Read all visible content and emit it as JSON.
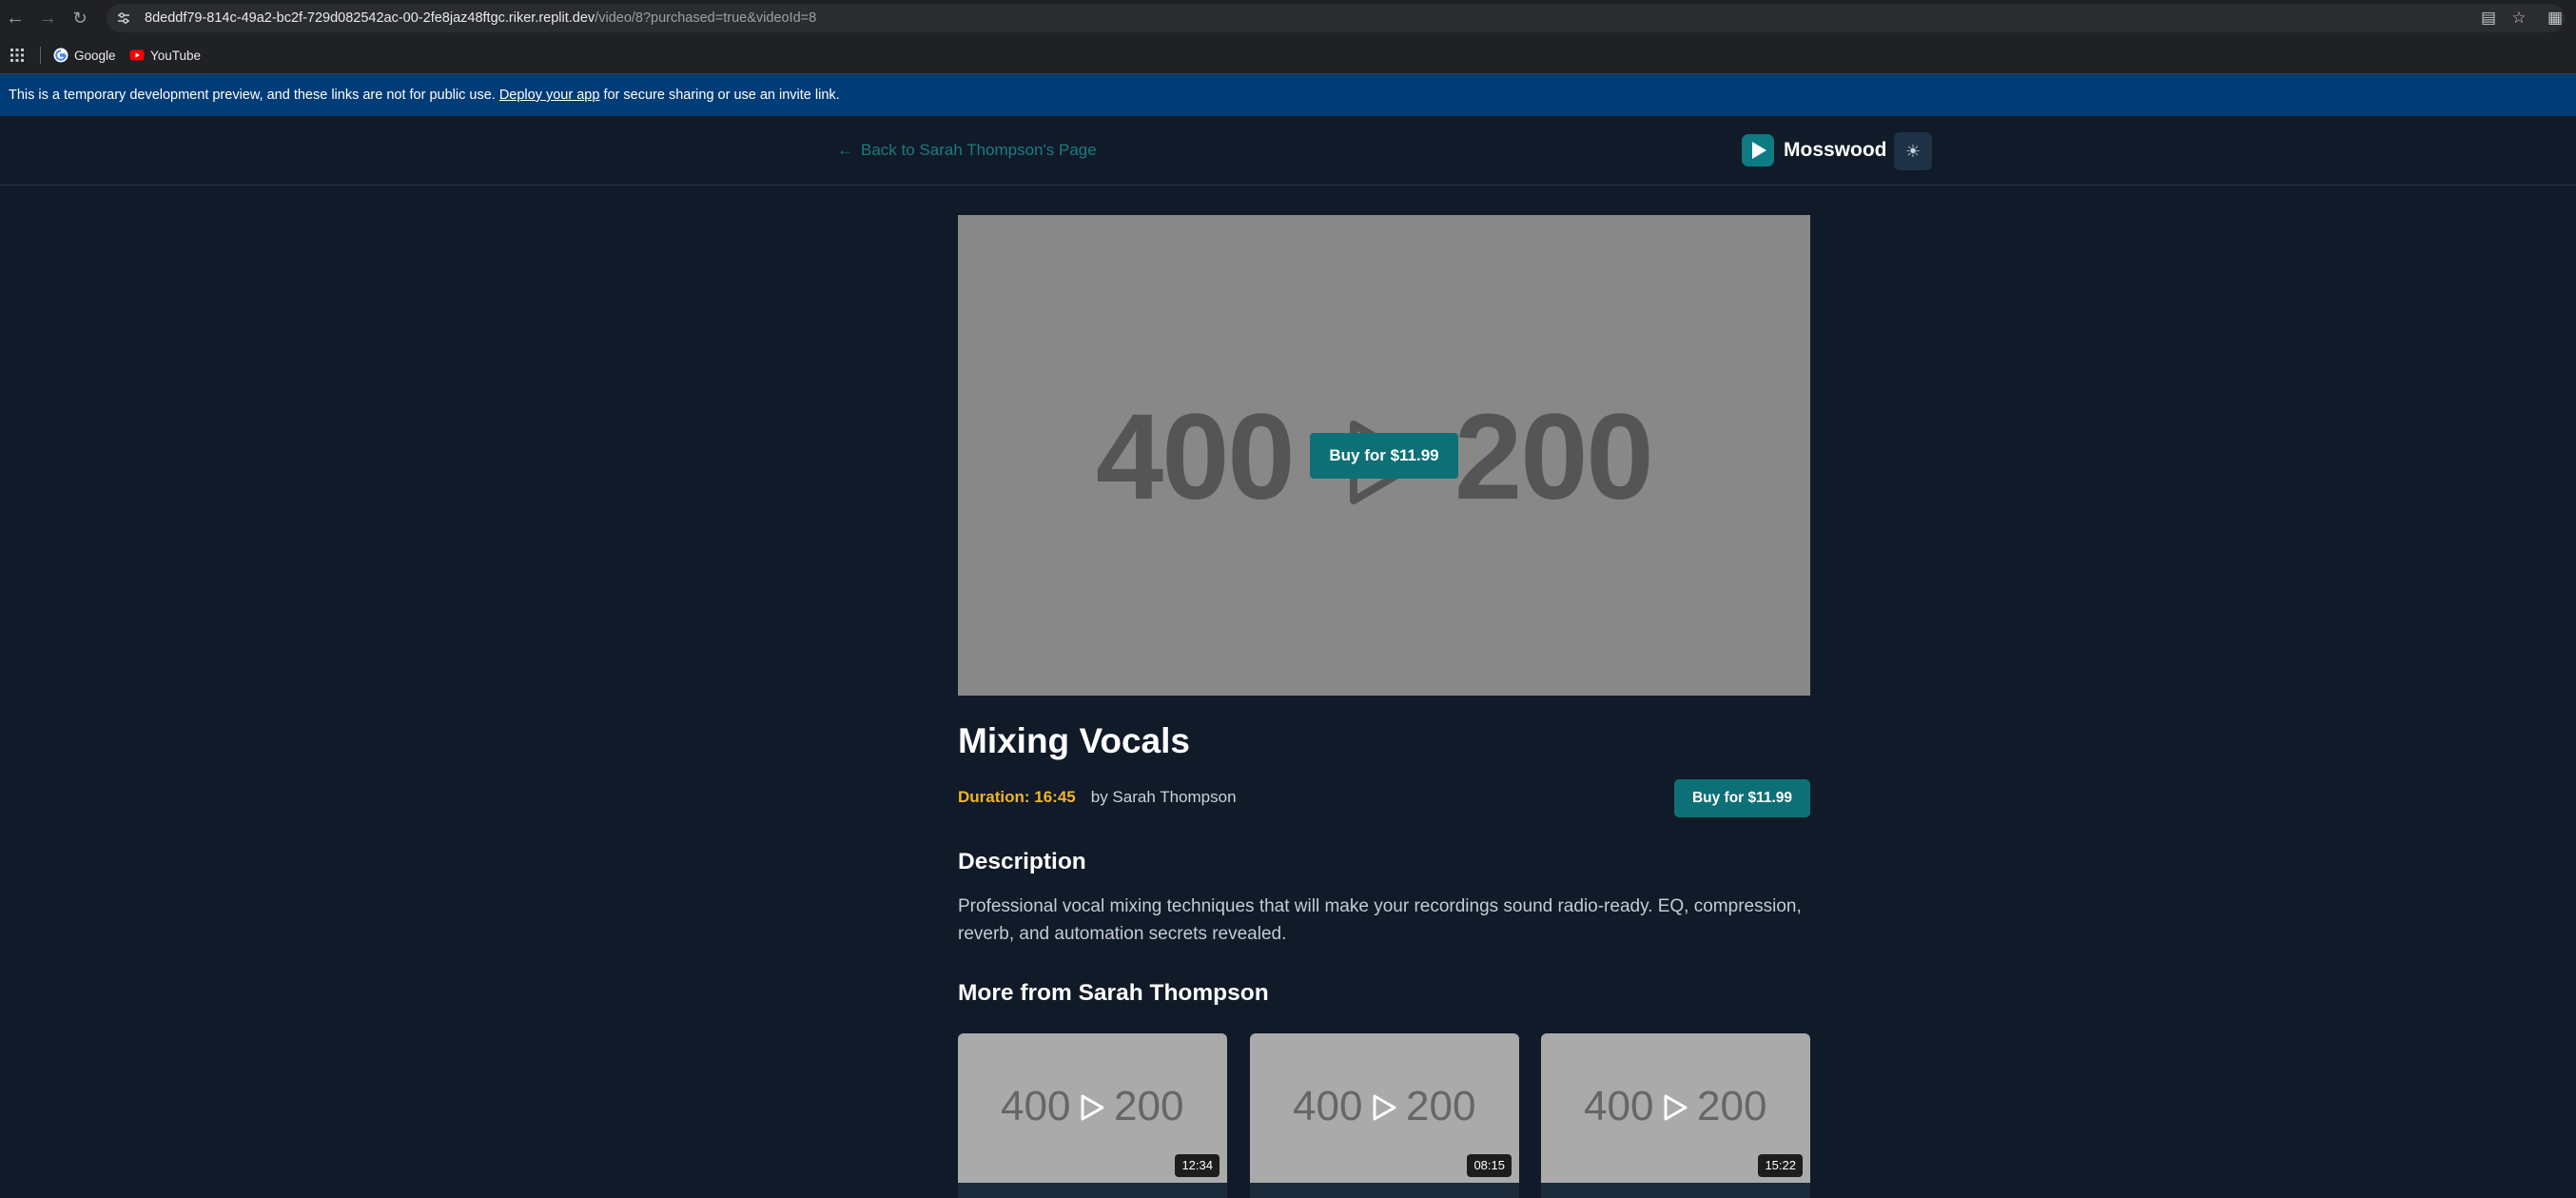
{
  "browser": {
    "url_host": "8deddf79-814c-49a2-bc2f-729d082542ac-00-2fe8jaz48ftgc.riker.replit.dev",
    "url_path": "/video/8?purchased=true&videoId=8",
    "bookmarks": [
      {
        "label": "Google"
      },
      {
        "label": "YouTube"
      }
    ]
  },
  "banner": {
    "text_before": "This is a temporary development preview, and these links are not for public use.",
    "link": "Deploy your app",
    "text_after": "for secure sharing or use an invite link."
  },
  "header": {
    "back_label": "Back to Sarah Thompson's Page",
    "brand": "Mosswood",
    "accent_color": "#0d7077"
  },
  "player": {
    "placeholder_left": "400",
    "placeholder_right": "200",
    "buy_label": "Buy for $11.99"
  },
  "video": {
    "title": "Mixing Vocals",
    "duration": "Duration: 16:45",
    "byline": "by Sarah Thompson",
    "buy_label": "Buy for $11.99",
    "description_heading": "Description",
    "description": "Professional vocal mixing techniques that will make your recordings sound radio-ready. EQ, compression, reverb, and automation secrets revealed."
  },
  "related": {
    "heading": "More from Sarah Thompson",
    "cards": [
      {
        "left": "400",
        "right": "200",
        "duration": "12:34"
      },
      {
        "left": "400",
        "right": "200",
        "duration": "08:15"
      },
      {
        "left": "400",
        "right": "200",
        "duration": "15:22"
      }
    ]
  }
}
